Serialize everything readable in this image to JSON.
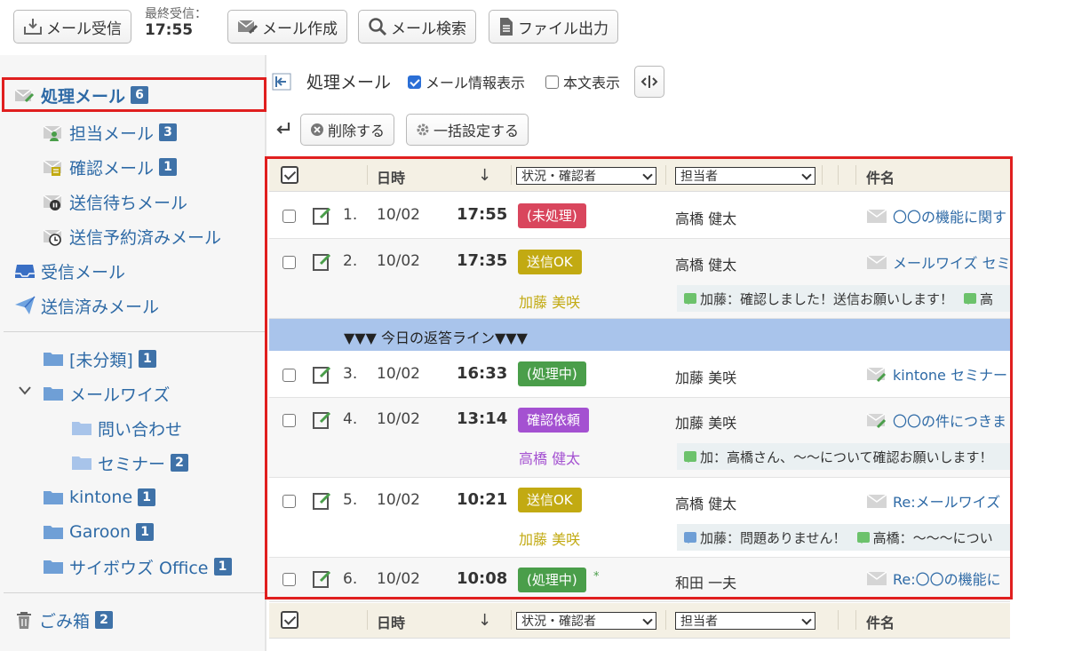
{
  "toolbar": {
    "receive_label": "メール受信",
    "last_received_label": "最終受信：",
    "last_received_time": "17:55",
    "compose_label": "メール作成",
    "search_label": "メール検索",
    "export_label": "ファイル出力"
  },
  "sidebar": {
    "processing": {
      "label": "処理メール",
      "count": "6"
    },
    "sub_items": [
      {
        "label": "担当メール",
        "count": "3"
      },
      {
        "label": "確認メール",
        "count": "1"
      },
      {
        "label": "送信待ちメール",
        "count": ""
      },
      {
        "label": "送信予約済みメール",
        "count": ""
      }
    ],
    "inbox_label": "受信メール",
    "sent_label": "送信済みメール",
    "folders": [
      {
        "label": "[未分類]",
        "count": "1"
      },
      {
        "label": "メールワイズ",
        "count": ""
      },
      {
        "label": "問い合わせ",
        "count": ""
      },
      {
        "label": "セミナー",
        "count": "2"
      },
      {
        "label": "kintone",
        "count": "1"
      },
      {
        "label": "Garoon",
        "count": "1"
      },
      {
        "label": "サイボウズ Office",
        "count": "1"
      }
    ],
    "trash": {
      "label": "ごみ箱",
      "count": "2"
    }
  },
  "main": {
    "title": "処理メール",
    "show_mail_info_label": "メール情報表示",
    "show_body_label": "本文表示",
    "delete_label": "削除する",
    "bulk_label": "一括設定する"
  },
  "table": {
    "header": {
      "datetime": "日時",
      "sort_arrow": "↓",
      "status_select": "状況・確認者",
      "assignee_select": "担当者",
      "subject": "件名"
    },
    "today_line": "▼▼▼ 今日の返答ライン▼▼▼",
    "rows": [
      {
        "num": "1.",
        "date": "10/02",
        "time": "17:55",
        "status": "(未処理)",
        "assignee": "高橋 健太",
        "subject": "〇〇の機能に関す"
      },
      {
        "num": "2.",
        "date": "10/02",
        "time": "17:35",
        "status": "送信OK",
        "confirmer": "加藤 美咲",
        "assignee": "高橋 健太",
        "subject": "メールワイズ セミ",
        "comment": "加藤：確認しました！送信お願いします！",
        "comment2": "高"
      },
      {
        "num": "3.",
        "date": "10/02",
        "time": "16:33",
        "status": "(処理中)",
        "assignee": "加藤 美咲",
        "subject": "kintone セミナー"
      },
      {
        "num": "4.",
        "date": "10/02",
        "time": "13:14",
        "status": "確認依頼",
        "confirmer": "高橋 健太",
        "assignee": "加藤 美咲",
        "subject": "〇〇の件につきま",
        "comment": "加：高橋さん、〜〜について確認お願いします！"
      },
      {
        "num": "5.",
        "date": "10/02",
        "time": "10:21",
        "status": "送信OK",
        "confirmer": "加藤 美咲",
        "assignee": "高橋 健太",
        "subject": "Re:メールワイズ",
        "comment": "加藤：問題ありません！",
        "comment2": "高橋：〜〜〜につい"
      },
      {
        "num": "6.",
        "date": "10/02",
        "time": "10:08",
        "status": "(処理中)",
        "star": "*",
        "assignee": "和田 一夫",
        "subject": "Re:〇〇の機能に"
      }
    ]
  },
  "colors": {
    "unprocessed": "#d9465d",
    "send_ok": "#c2aa12",
    "processing": "#4a9e4a",
    "confirm_request": "#a451d1",
    "link": "#2e6aa6",
    "count_badge": "#3f72a8",
    "today_line": "#a9c4eb",
    "highlight": "#e01f1f"
  }
}
